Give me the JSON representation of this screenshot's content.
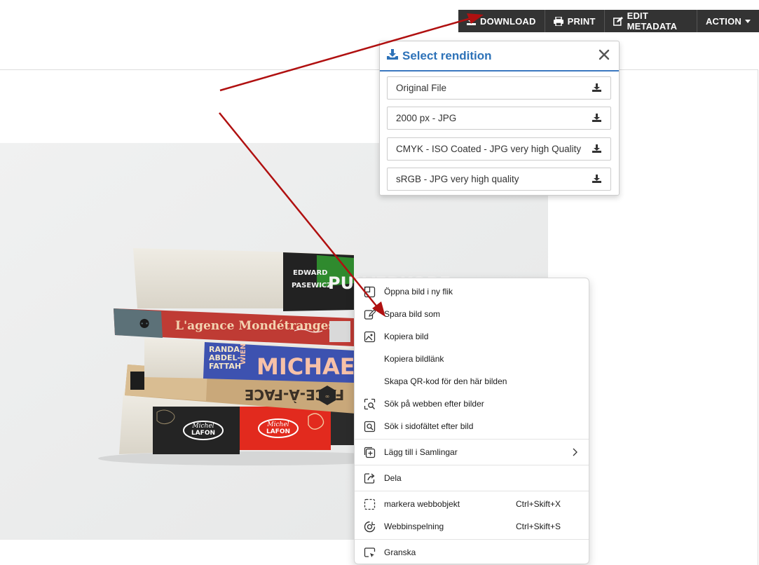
{
  "toolbar": {
    "download": "DOWNLOAD",
    "print": "PRINT",
    "edit_metadata": "EDIT METADATA",
    "action": "ACTION",
    "icons": [
      "download-icon",
      "print-icon",
      "edit-icon",
      "caret-down-icon"
    ]
  },
  "rendition_panel": {
    "title": "Select rendition",
    "title_color": "#2d72b8",
    "items": [
      {
        "label": "Original File"
      },
      {
        "label": "2000 px - JPG"
      },
      {
        "label": "CMYK - ISO Coated - JPG very high Quality"
      },
      {
        "label": "sRGB - JPG very high quality"
      }
    ]
  },
  "context_menu": {
    "items": [
      {
        "label": "Öppna bild i ny flik",
        "icon": "new-tab-icon"
      },
      {
        "label": "Spara bild som",
        "icon": "save-image-icon"
      },
      {
        "label": "Kopiera bild",
        "icon": "copy-image-icon"
      },
      {
        "label": "Kopiera bildlänk",
        "icon": ""
      },
      {
        "label": "Skapa QR-kod för den här bilden",
        "icon": ""
      },
      {
        "label": "Sök på webben efter bilder",
        "icon": "visual-search-icon"
      },
      {
        "label": "Sök i sidofältet efter bild",
        "icon": "sidebar-search-icon"
      },
      {
        "label": "Lägg till i Samlingar",
        "icon": "collections-icon"
      },
      {
        "label": "Dela",
        "icon": "share-icon"
      },
      {
        "label": "markera webbobjekt",
        "icon": "web-select-icon",
        "shortcut": "Ctrl+Skift+X"
      },
      {
        "label": "Webbinspelning",
        "icon": "web-capture-icon",
        "shortcut": "Ctrl+Skift+S"
      },
      {
        "label": "Granska",
        "icon": "inspect-icon"
      }
    ]
  },
  "photo": {
    "book_texts": {
      "author1": "EDWARD",
      "author2": "PASEWICZ",
      "title1": "PULVERKORF",
      "title2": "L'agence Mondétranges",
      "title3_top": "RANDA",
      "title3_a": "ABDEL-",
      "title3_b": "FATTAH",
      "title3_c": "WIEN",
      "title3": "MICHAEL",
      "title4": "FACE-À-FACE",
      "publisher": "Michel LAFON"
    }
  },
  "colors": {
    "toolbar_bg": "#333333",
    "arrow": "#b01010",
    "photo_bg": "#eceded"
  }
}
